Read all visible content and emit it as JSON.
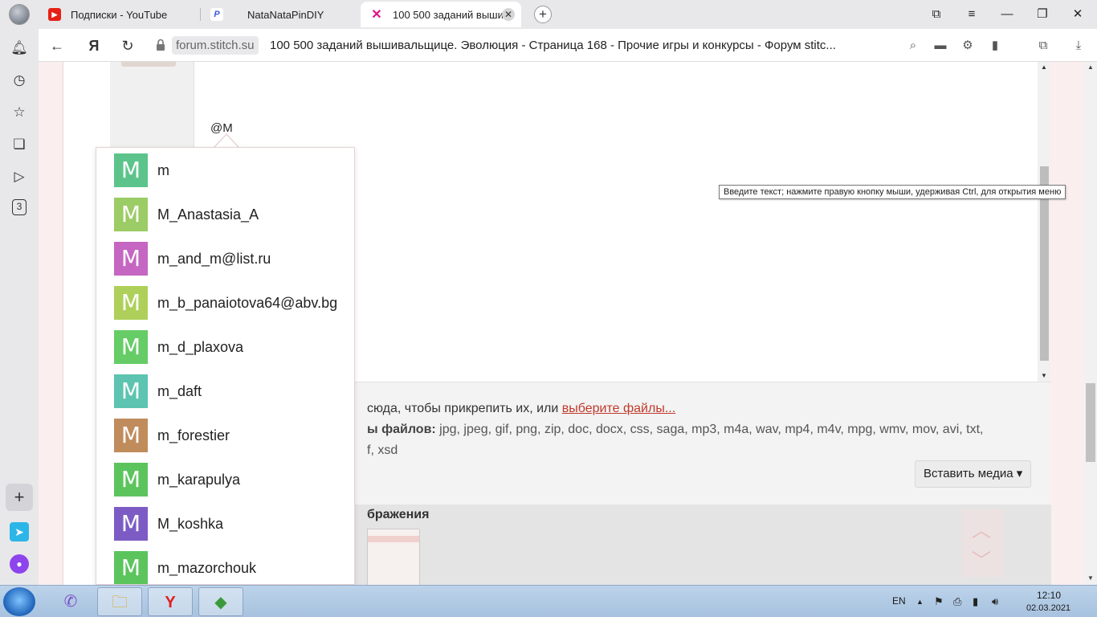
{
  "browser": {
    "tabs": [
      {
        "label": "Подписки - YouTube",
        "icon": "youtube-icon",
        "color": "#e62117"
      },
      {
        "label": "NataNataPinDIY",
        "icon": "pinterest-app-icon",
        "color": "#3b5bdb"
      },
      {
        "label": "100 500 заданий выши",
        "icon": "stitch-icon",
        "color": "#e0158a"
      }
    ],
    "close_glyph": "✕",
    "new_tab_glyph": "+",
    "url_domain": "forum.stitch.su",
    "page_title": "100 500 заданий вышивальщице. Эволюция - Страница 168 - Прочие игры и конкурсы - Форум stitc..."
  },
  "editor": {
    "text": "@M",
    "tooltip": "Введите текст; нажмите правую кнопку мыши, удерживая Ctrl, для открытия меню"
  },
  "attachments": {
    "line1_prefix": "сюда, чтобы прикрепить их, или ",
    "line1_link": "выберите файлы...",
    "line2_bold": "ы файлов:",
    "line2_rest": " jpg, jpeg, gif, png, zip, doc, docx, css, saga, mp3, m4a, wav, mp4, m4v, mpg, wmv, mov, avi, txt,",
    "line3": "f, xsd",
    "insert_media": "Вставить медиа ▾",
    "images_title": "бражения"
  },
  "mentions": [
    {
      "letter": "M",
      "name": "m",
      "color": "#5cc48a"
    },
    {
      "letter": "M",
      "name": "M_Anastasia_A",
      "color": "#9ccc65"
    },
    {
      "letter": "M",
      "name": "m_and_m@list.ru",
      "color": "#c566c2"
    },
    {
      "letter": "M",
      "name": "m_b_panaiotova64@abv.bg",
      "color": "#aed05a"
    },
    {
      "letter": "M",
      "name": "m_d_plaxova",
      "color": "#66cc66"
    },
    {
      "letter": "M",
      "name": "m_daft",
      "color": "#5cc4b0"
    },
    {
      "letter": "M",
      "name": "m_forestier",
      "color": "#c08c5c"
    },
    {
      "letter": "M",
      "name": "m_karapulya",
      "color": "#5cc45c"
    },
    {
      "letter": "M",
      "name": "M_koshka",
      "color": "#7c5cc4"
    },
    {
      "letter": "M",
      "name": "m_mazorchouk",
      "color": "#5cc45c"
    }
  ],
  "taskbar": {
    "lang": "EN",
    "time": "12:10",
    "date": "02.03.2021"
  }
}
